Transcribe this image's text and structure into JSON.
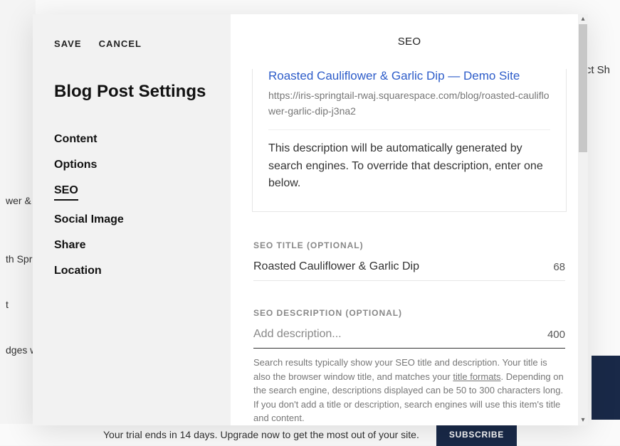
{
  "background": {
    "sidebar_rows": [
      "wer & Ga",
      "th Spri",
      "t",
      "dges w"
    ],
    "topbar_right": "ct   Sh",
    "trial_text": "Your trial ends in 14 days. Upgrade now to get the most out of your site.",
    "subscribe": "SUBSCRIBE"
  },
  "modal": {
    "actions": {
      "save": "SAVE",
      "cancel": "CANCEL"
    },
    "title": "Blog Post Settings",
    "tabs": [
      {
        "key": "content",
        "label": "Content",
        "active": false
      },
      {
        "key": "options",
        "label": "Options",
        "active": false
      },
      {
        "key": "seo",
        "label": "SEO",
        "active": true
      },
      {
        "key": "social-image",
        "label": "Social Image",
        "active": false
      },
      {
        "key": "share",
        "label": "Share",
        "active": false
      },
      {
        "key": "location",
        "label": "Location",
        "active": false
      }
    ],
    "panel_title": "SEO",
    "preview": {
      "title": "Roasted Cauliflower & Garlic Dip — Demo Site",
      "url": "https://iris-springtail-rwaj.squarespace.com/blog/roasted-cauliflower-garlic-dip-j3na2",
      "desc": "This description will be automatically generated by search engines. To override that description, enter one below."
    },
    "seo_title": {
      "label": "SEO TITLE (OPTIONAL)",
      "value": "Roasted Cauliflower & Garlic Dip",
      "count": "68"
    },
    "seo_desc": {
      "label": "SEO DESCRIPTION (OPTIONAL)",
      "placeholder": "Add description...",
      "value": "",
      "count": "400",
      "help_pre": "Search results typically show your SEO title and description. Your title is also the browser window title, and matches your ",
      "help_link": "title formats",
      "help_post": ". Depending on the search engine, descriptions displayed can be 50 to 300 characters long. If you don't add a title or description, search engines will use this item's title and content."
    }
  }
}
